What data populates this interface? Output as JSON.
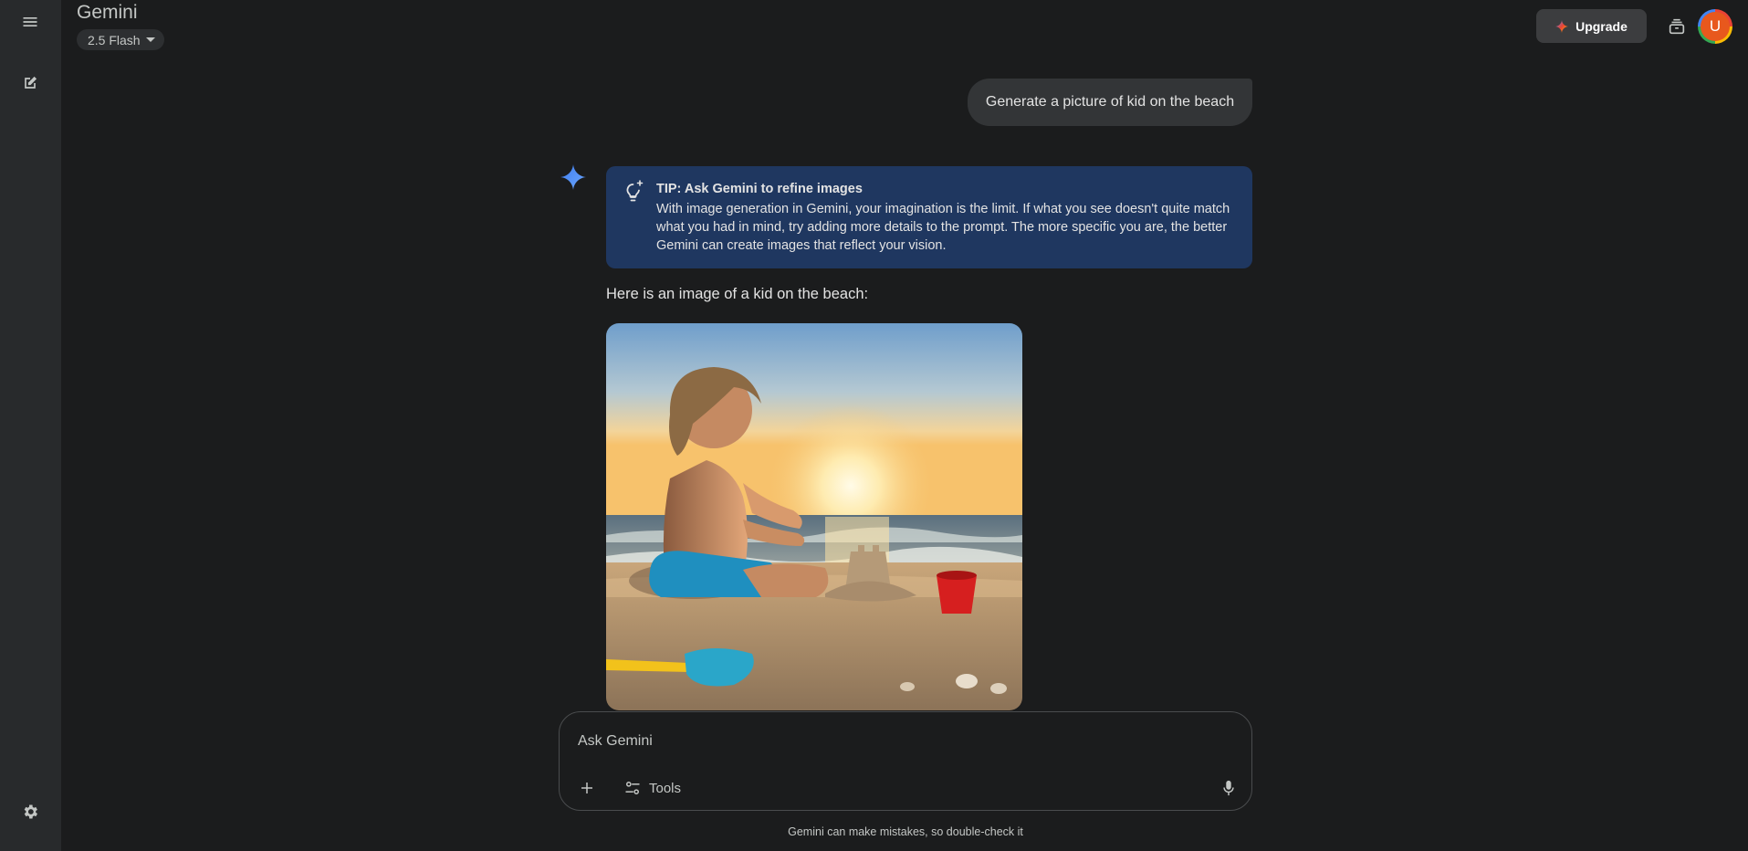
{
  "rail": {
    "menu_icon": "menu-icon",
    "new_chat_icon": "edit-icon",
    "settings_icon": "settings-icon"
  },
  "header": {
    "title": "Gemini",
    "model": "2.5 Flash",
    "upgrade_label": "Upgrade",
    "avatar_initial": "U"
  },
  "conversation": {
    "user_prompt": "Generate a picture of kid on the beach",
    "tip": {
      "title": "TIP: Ask Gemini to refine images",
      "body": "With image generation in Gemini, your imagination is the limit. If what you see doesn't quite match what you had in mind, try adding more details to the prompt. The more specific you are, the better Gemini can create images that reflect your vision."
    },
    "response_text": "Here is an image of a kid on the beach:"
  },
  "composer": {
    "placeholder": "Ask Gemini",
    "tools_label": "Tools"
  },
  "footer": {
    "disclaimer": "Gemini can make mistakes, so double-check it"
  },
  "colors": {
    "background": "#1b1c1d",
    "rail": "#282a2c",
    "tip_card": "#1f3760",
    "user_bubble": "#333537",
    "accent_blue": "#4a8cf7"
  }
}
